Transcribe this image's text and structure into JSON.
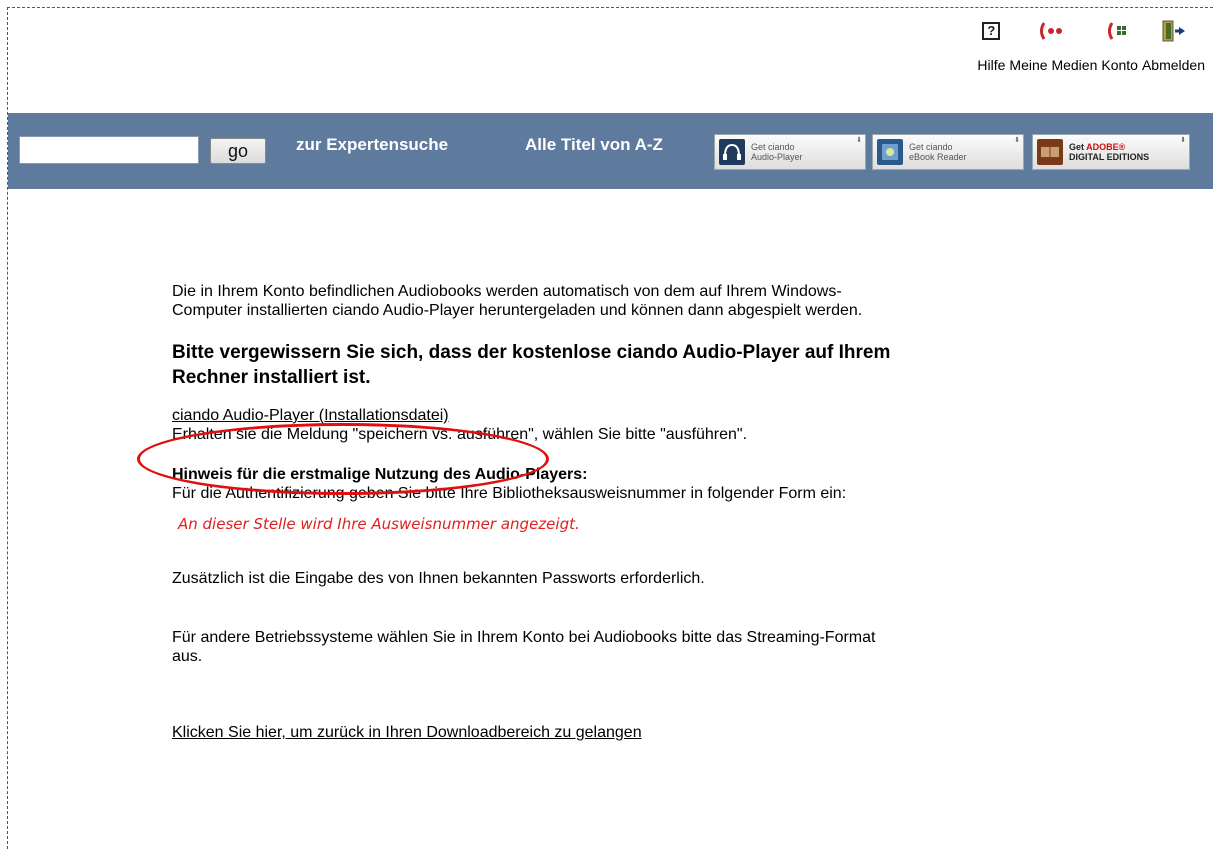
{
  "topnav": {
    "help_label": "Hilfe",
    "help_icon_text": "?",
    "media_label": "Meine Medien",
    "account_label": "Konto",
    "logout_label": "Abmelden"
  },
  "toolbar": {
    "search_value": "",
    "go_label": "go",
    "expert_search": "zur Expertensuche",
    "all_titles": "Alle Titel von A-Z",
    "badge_audio": "Get ciando\nAudio-Player",
    "badge_ebook": "Get ciando\neBook Reader",
    "badge_adobe_get": "Get ",
    "badge_adobe_brand": "ADOBE®",
    "badge_adobe_rest": "DIGITAL EDITIONS"
  },
  "content": {
    "intro": "Die in Ihrem Konto befindlichen Audiobooks werden automatisch von dem auf Ihrem Windows-Computer installierten ciando Audio-Player heruntergeladen und können dann abgespielt werden.",
    "heading": "Bitte vergewissern Sie sich, dass der kostenlose ciando Audio-Player auf Ihrem Rechner installiert ist.",
    "install_link": "ciando Audio-Player (Installationsdatei)",
    "install_note": "Erhalten sie die Meldung \"speichern vs. ausführen\", wählen Sie bitte \"ausführen\".",
    "hint_title": "Hinweis für die erstmalige Nutzung des Audio-Players:",
    "hint_text": "Für die Authentifizierung geben Sie bitte Ihre Bibliotheksausweisnummer in folgender Form ein:",
    "id_placeholder": "An dieser Stelle wird Ihre Ausweisnummer angezeigt.",
    "password_note": "Zusätzlich ist die Eingabe des von Ihnen bekannten Passworts erforderlich.",
    "other_os": "Für andere Betriebssysteme wählen Sie in Ihrem Konto bei Audiobooks bitte das Streaming-Format aus.",
    "back_link": "Klicken Sie hier, um zurück in Ihren Downloadbereich zu gelangen"
  },
  "colors": {
    "toolbar_bg": "#5e7a9c",
    "annotation_red": "#e01010",
    "placeholder_red": "#e02020"
  }
}
